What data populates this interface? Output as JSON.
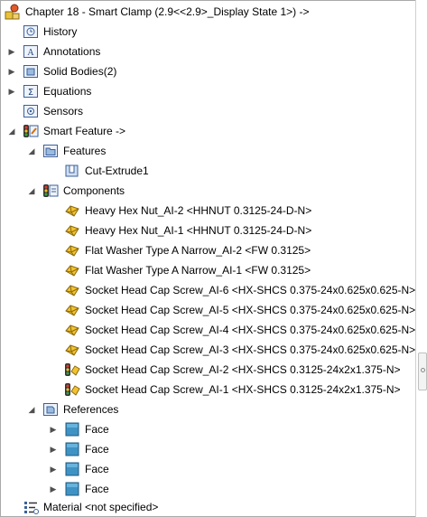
{
  "tree": {
    "title": "Chapter 18 - Smart Clamp  (2.9<<2.9>_Display State 1>) ->",
    "items": [
      {
        "label": "History"
      },
      {
        "label": "Annotations"
      },
      {
        "label": "Solid Bodies(2)"
      },
      {
        "label": "Equations"
      },
      {
        "label": "Sensors"
      },
      {
        "label": "Smart Feature ->"
      },
      {
        "label": "Features"
      },
      {
        "label": "Cut-Extrude1"
      },
      {
        "label": "Components"
      },
      {
        "label": "Heavy Hex Nut_AI-2  <HHNUT 0.3125-24-D-N>"
      },
      {
        "label": "Heavy Hex Nut_AI-1  <HHNUT 0.3125-24-D-N>"
      },
      {
        "label": "Flat Washer Type A Narrow_AI-2  <FW 0.3125>"
      },
      {
        "label": "Flat Washer Type A Narrow_AI-1  <FW 0.3125>"
      },
      {
        "label": "Socket Head Cap Screw_AI-6  <HX-SHCS 0.375-24x0.625x0.625-N>"
      },
      {
        "label": "Socket Head Cap Screw_AI-5  <HX-SHCS 0.375-24x0.625x0.625-N>"
      },
      {
        "label": "Socket Head Cap Screw_AI-4  <HX-SHCS 0.375-24x0.625x0.625-N>"
      },
      {
        "label": "Socket Head Cap Screw_AI-3  <HX-SHCS 0.375-24x0.625x0.625-N>"
      },
      {
        "label": "Socket Head Cap Screw_AI-2  <HX-SHCS 0.3125-24x2x1.375-N>"
      },
      {
        "label": "Socket Head Cap Screw_AI-1  <HX-SHCS 0.3125-24x2x1.375-N>"
      },
      {
        "label": "References"
      },
      {
        "label": "Face"
      },
      {
        "label": "Face"
      },
      {
        "label": "Face"
      },
      {
        "label": "Face"
      },
      {
        "label": "Material <not specified>"
      }
    ]
  }
}
